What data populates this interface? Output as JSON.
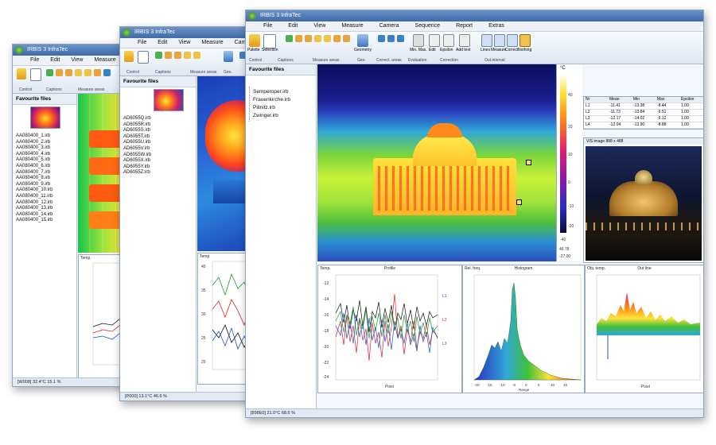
{
  "window_title": "IRBIS 3 InfraTec",
  "menu": [
    "File",
    "Edit",
    "View",
    "Measure",
    "Camera",
    "Sequence",
    "Report",
    "Extras"
  ],
  "ribbon": {
    "buttons": [
      "Palette",
      "Selection",
      "Geometry",
      "Min. Max.",
      "Edit",
      "Epsilon",
      "Add text",
      "Lines",
      "Measure",
      "Correct",
      "Nothing"
    ],
    "groups": [
      "Control",
      "Captions",
      "Measure areas",
      "Geo.",
      "Correct. areas",
      "Evaluation",
      "Correction",
      "Out.interval",
      "Palette",
      "Seq."
    ]
  },
  "favourite_files_label": "Favourite files",
  "back_files": [
    "AA080400_1.irb",
    "AA080400_2.irb",
    "AA080400_3.irb",
    "AA080400_4.irb",
    "AA080400_5.irb",
    "AA080400_6.irb",
    "AA080400_7.irb",
    "AA080400_8.irb",
    "AA080400_9.irb",
    "AA080400_10.irb",
    "AA080400_11.irb",
    "AA080400_12.irb",
    "AA080400_13.irb",
    "AA080400_14.irb",
    "AA080400_15.irb"
  ],
  "middle_files": [
    "AD6055Q.irb",
    "AD6055R.irb",
    "AD6055S.irb",
    "AD6055T.irb",
    "AD6055U.irb",
    "AD6055V.irb",
    "AD6055W.irb",
    "AD6055X.irb",
    "AD6055Y.irb",
    "AD6055Z.irb"
  ],
  "front_files": [
    "Semperoper.irb",
    "Frauenkirche.irb",
    "Pillnitz.irb",
    "Zwinger.irb"
  ],
  "scale": {
    "unit": "°C",
    "top": "46.78",
    "bottom": "-27.00",
    "low_label": "-40",
    "ticks": [
      "40",
      "20",
      "10",
      "0",
      "-10",
      "-20"
    ]
  },
  "table": {
    "headers": [
      "Nr",
      "Mean",
      "Min",
      "Max",
      "Epsilon"
    ],
    "rows": [
      [
        "L1",
        "-11.41",
        "-13.38",
        "-8.44",
        "1.00"
      ],
      [
        "L2",
        "-11.73",
        "-13.84",
        "-9.51",
        "1.00"
      ],
      [
        "L3",
        "-12.17",
        "-14.02",
        "-9.12",
        "1.00"
      ],
      [
        "L4",
        "-12.04",
        "-13.90",
        "-8.88",
        "1.00"
      ]
    ]
  },
  "vis_image_label": "VIS image 888 x 488",
  "charts": {
    "profile": {
      "title": "Profile",
      "ylabel": "Temp.",
      "xlabel": "Pixel",
      "yticks": [
        "-12",
        "-14",
        "-16",
        "-18",
        "-20",
        "-22",
        "-24"
      ],
      "legend": [
        "L1",
        "L2",
        "L3"
      ]
    },
    "histogram": {
      "title": "Histogram",
      "ylabel": "Rel. freq.",
      "xlabel": "Range",
      "xticks": [
        "-20",
        "-15",
        "-10",
        "-5",
        "0",
        "5",
        "10",
        "15"
      ]
    },
    "outline": {
      "title": "Out line",
      "ylabel": "Obj. temp.",
      "xlabel": "Pixel"
    },
    "middle_plot": {
      "ylabel": "Temp.",
      "yticks": [
        "40",
        "35",
        "30",
        "25",
        "20"
      ]
    },
    "back_plot": {
      "ylabel": "Temp."
    }
  },
  "status": {
    "front": "[898E0]  21.0°C   68.6 %",
    "middle": "[P000]  13.1°C   46.6 %",
    "back": "[W008]  32.4°C   15.1 %"
  }
}
